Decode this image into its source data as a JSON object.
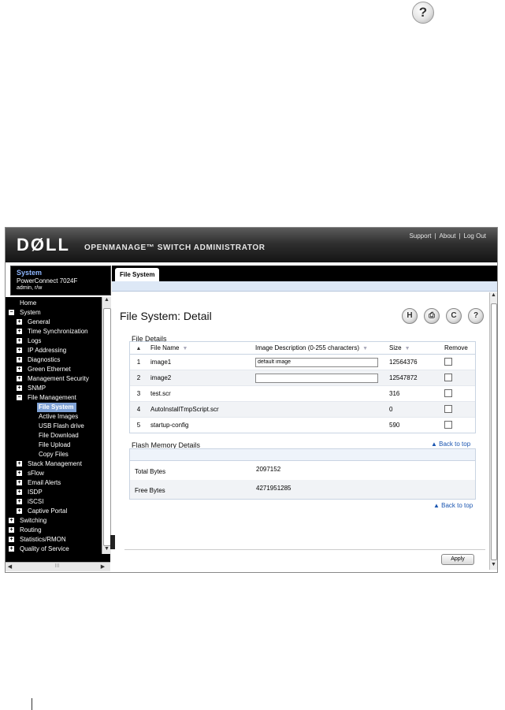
{
  "page": {
    "help_icon": "?"
  },
  "banner": {
    "logo": "DØLL",
    "app_title": "OPENMANAGE™ SWITCH ADMINISTRATOR",
    "links": [
      "Support",
      "About",
      "Log Out"
    ]
  },
  "system": {
    "title": "System",
    "model": "PowerConnect 7024F",
    "user": "admin, r/w"
  },
  "tab": {
    "label": "File System"
  },
  "nav": {
    "items": [
      {
        "label": "Home",
        "exp": ""
      },
      {
        "label": "System",
        "exp": "−"
      },
      {
        "label": "General",
        "exp": "+"
      },
      {
        "label": "Time Synchronization",
        "exp": "+"
      },
      {
        "label": "Logs",
        "exp": "+"
      },
      {
        "label": "IP Addressing",
        "exp": "+"
      },
      {
        "label": "Diagnostics",
        "exp": "+"
      },
      {
        "label": "Green Ethernet",
        "exp": "+"
      },
      {
        "label": "Management Security",
        "exp": "+"
      },
      {
        "label": "SNMP",
        "exp": "+"
      },
      {
        "label": "File Management",
        "exp": "−"
      },
      {
        "label": "File System",
        "exp": ""
      },
      {
        "label": "Active Images",
        "exp": ""
      },
      {
        "label": "USB Flash drive",
        "exp": ""
      },
      {
        "label": "File Download",
        "exp": ""
      },
      {
        "label": "File Upload",
        "exp": ""
      },
      {
        "label": "Copy Files",
        "exp": ""
      },
      {
        "label": "Stack Management",
        "exp": "+"
      },
      {
        "label": "sFlow",
        "exp": "+"
      },
      {
        "label": "Email Alerts",
        "exp": "+"
      },
      {
        "label": "ISDP",
        "exp": "+"
      },
      {
        "label": "iSCSI",
        "exp": "+"
      },
      {
        "label": "Captive Portal",
        "exp": "+"
      },
      {
        "label": "Switching",
        "exp": "+"
      },
      {
        "label": "Routing",
        "exp": "+"
      },
      {
        "label": "Statistics/RMON",
        "exp": "+"
      },
      {
        "label": "Quality of Service",
        "exp": "+"
      }
    ],
    "selected": "File System",
    "hscroll_mark": "III"
  },
  "content": {
    "heading": "File System: Detail",
    "toolbar": {
      "save": "H",
      "print": "⎙",
      "refresh": "C",
      "help": "?"
    },
    "file_details": {
      "title": "File Details",
      "sort_glyph": "▲",
      "columns": [
        "File Name",
        "Image Description (0-255 characters)",
        "Size",
        "Remove"
      ],
      "rows": [
        {
          "num": "1",
          "name": "image1",
          "desc": "default image",
          "has_input": true,
          "size": "12564376"
        },
        {
          "num": "2",
          "name": "image2",
          "desc": "",
          "has_input": true,
          "size": "12547872"
        },
        {
          "num": "3",
          "name": "test.scr",
          "desc": "",
          "has_input": false,
          "size": "316"
        },
        {
          "num": "4",
          "name": "AutoInstallTmpScript.scr",
          "desc": "",
          "has_input": false,
          "size": "0"
        },
        {
          "num": "5",
          "name": "startup-config",
          "desc": "",
          "has_input": false,
          "size": "590"
        }
      ]
    },
    "flash": {
      "title": "Flash Memory Details",
      "rows": [
        {
          "label": "Total Bytes",
          "value": "2097152"
        },
        {
          "label": "Free Bytes",
          "value": "4271951285"
        }
      ]
    },
    "back_to_top_1": "▲ Back to top",
    "back_to_top_2": "▲ Back to top",
    "apply": "Apply"
  }
}
